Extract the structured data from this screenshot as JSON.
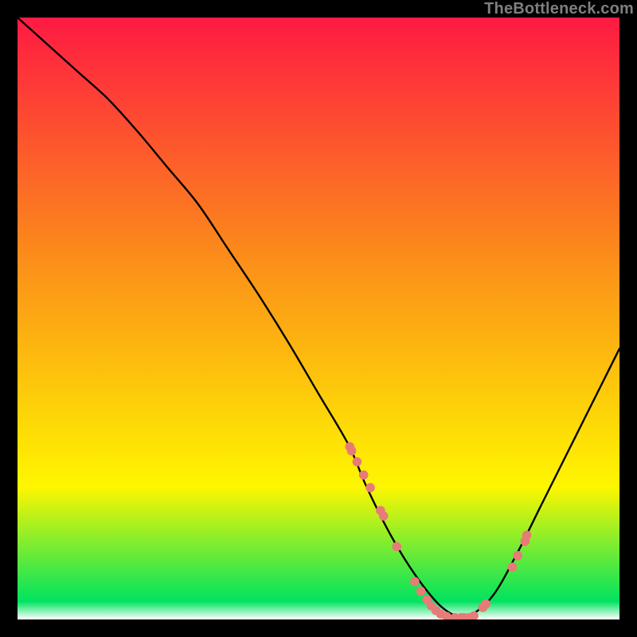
{
  "attribution": "TheBottleneck.com",
  "chart_data": {
    "type": "line",
    "title": "",
    "xlabel": "",
    "ylabel": "",
    "xlim": [
      0,
      100
    ],
    "ylim": [
      0,
      100
    ],
    "grid": false,
    "legend": false,
    "background_gradient": {
      "top": "#fe1a42",
      "mid1": "#fc8d1a",
      "mid2": "#fef600",
      "low": "#00e35f",
      "bottom": "#ffffff"
    },
    "curve": {
      "x": [
        0,
        5,
        10,
        15,
        20,
        25,
        30,
        35,
        40,
        45,
        50,
        55,
        58,
        62,
        66,
        70,
        73,
        75,
        79,
        83,
        87,
        91,
        95,
        100
      ],
      "y": [
        100,
        95.5,
        91,
        86.5,
        81,
        75,
        69,
        61.5,
        54,
        46,
        37.5,
        29,
        22,
        14,
        7.5,
        2.5,
        0.5,
        0.5,
        4,
        11,
        19,
        27,
        35,
        45
      ]
    },
    "markers": {
      "x": [
        55.2,
        55.5,
        56.4,
        57.5,
        58.6,
        60.3,
        60.8,
        63.0,
        66.0,
        67.0,
        68.0,
        68.7,
        69.5,
        70.3,
        71.3,
        72.7,
        73.7,
        74.2,
        75.0,
        75.8,
        77.3,
        77.8,
        82.2,
        83.1,
        84.3,
        84.6
      ],
      "y": [
        28.7,
        28.0,
        26.2,
        24.0,
        21.9,
        18.1,
        17.2,
        12.1,
        6.3,
        4.7,
        3.3,
        2.3,
        1.5,
        0.9,
        0.5,
        0.3,
        0.3,
        0.3,
        0.3,
        0.6,
        2.0,
        2.6,
        8.7,
        10.6,
        13.0,
        14.0
      ],
      "color": "#e67b77",
      "r": 5.8
    }
  }
}
